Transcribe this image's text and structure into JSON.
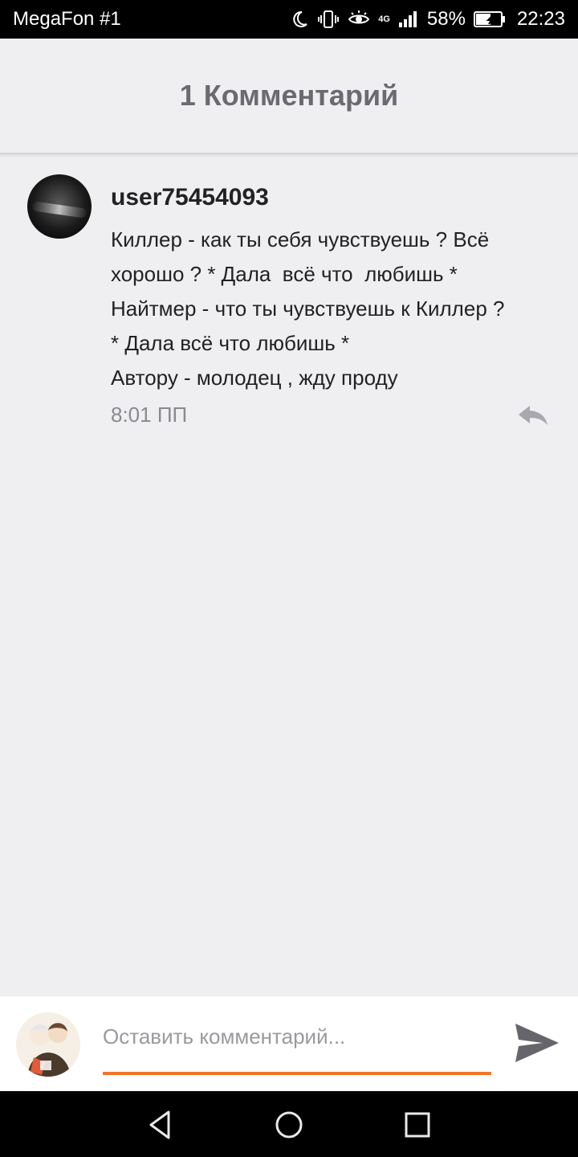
{
  "status_bar": {
    "carrier": "MegaFon #1",
    "network": "4G",
    "battery": "58%",
    "time": "22:23",
    "icons": [
      "moon-icon",
      "vibrate-icon",
      "eye-icon",
      "signal-icon",
      "battery-icon"
    ]
  },
  "header": {
    "title": "1 Комментарий"
  },
  "comment": {
    "username": "user75454093",
    "lines": [
      "Киллер - как ты себя чувствуешь ? Всё",
      "хорошо ? * Дала  всё что  любишь *",
      "Найтмер - что ты чувствуешь к Киллер ?",
      "* Дала всё что любишь *",
      "Автору - молодец , жду проду"
    ],
    "time": "8:01 ПП"
  },
  "composer": {
    "placeholder": "Оставить комментарий...",
    "value": ""
  },
  "colors": {
    "accent": "#f0752c",
    "background": "#efeef1",
    "header_title": "#6b6a70"
  }
}
